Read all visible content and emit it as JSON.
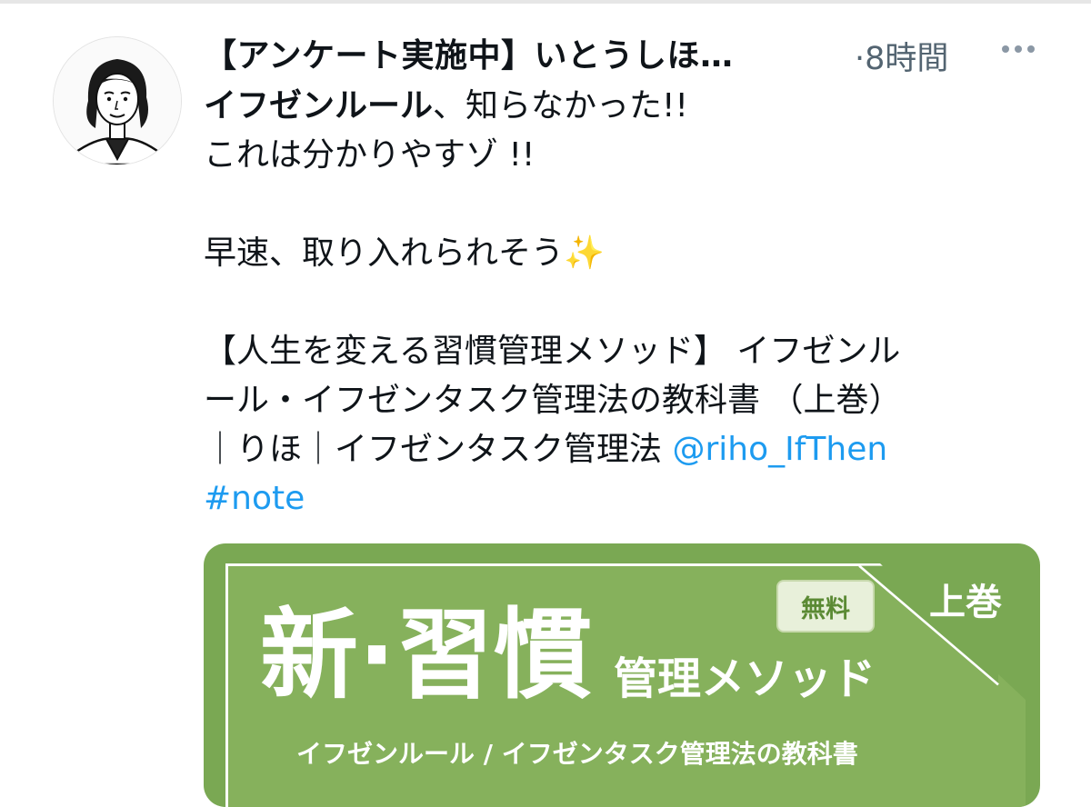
{
  "tweet": {
    "author": {
      "display_name": "【アンケート実施中】いとうしほ…"
    },
    "timestamp": "·8時間",
    "more_icon": "more-horizontal-icon",
    "text": {
      "line1_bold": "イフゼンルール",
      "line1_rest": "、知らなかった!!",
      "line2": "これは分かりやすゾ !!",
      "line3_text": "早速、取り入れられそう",
      "line3_emoji": "✨",
      "line4": "【人生を変える習慣管理メソッド】 イフゼンル",
      "line5": "ール・イフゼンタスク管理法の教科書 （上巻）",
      "line6_text": "｜りほ｜イフゼンタスク管理法 ",
      "mention": "@riho_IfThen",
      "hashtag": "#note"
    },
    "media_card": {
      "badge": "無料",
      "volume": "上巻",
      "title_main": "新·習慣",
      "title_sub": "管理メソッド",
      "subtitle": "イフゼンルール / イフゼンタスク管理法の教科書"
    }
  },
  "colors": {
    "link": "#1d9bf0",
    "card_green": "#7aa853",
    "muted": "#536471"
  }
}
